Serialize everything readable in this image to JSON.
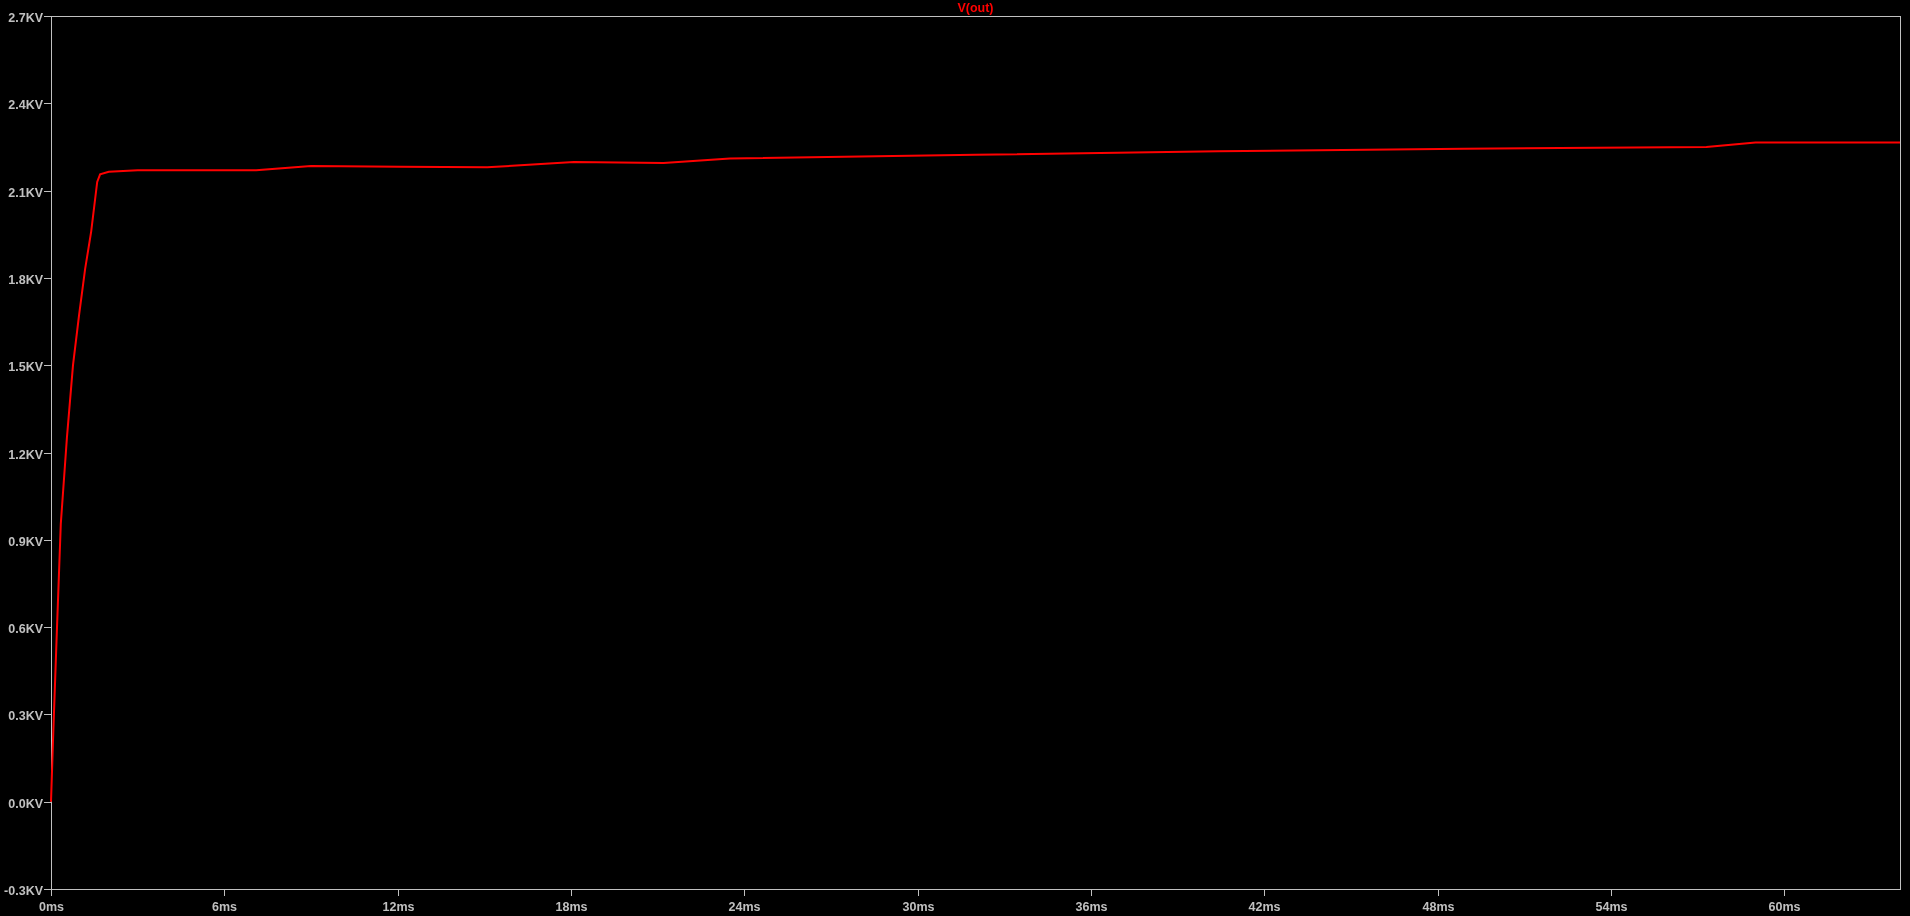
{
  "chart_data": {
    "type": "line",
    "x": [
      0,
      0.08,
      0.2,
      0.34,
      0.55,
      0.76,
      0.97,
      1.18,
      1.39,
      1.6,
      1.7,
      2.0,
      3.0,
      7.1,
      9,
      12.1,
      15.1,
      18.1,
      21.2,
      23.5,
      32,
      40.4,
      48.9,
      57.3,
      59,
      64
    ],
    "series": [
      {
        "name": "V(out)",
        "color": "#ff0000",
        "values": [
          0,
          0.24,
          0.58,
          0.955,
          1.25,
          1.5,
          1.67,
          1.83,
          1.96,
          2.13,
          2.156,
          2.165,
          2.17,
          2.17,
          2.185,
          2.182,
          2.18,
          2.198,
          2.195,
          2.21,
          2.223,
          2.235,
          2.244,
          2.25,
          2.265,
          2.265
        ]
      }
    ],
    "xlim": [
      0,
      64
    ],
    "ylim": [
      -0.3,
      2.7
    ],
    "xticks": [
      {
        "value": 0,
        "label": "0ms"
      },
      {
        "value": 6,
        "label": "6ms"
      },
      {
        "value": 12,
        "label": "12ms"
      },
      {
        "value": 18,
        "label": "18ms"
      },
      {
        "value": 24,
        "label": "24ms"
      },
      {
        "value": 30,
        "label": "30ms"
      },
      {
        "value": 36,
        "label": "36ms"
      },
      {
        "value": 42,
        "label": "42ms"
      },
      {
        "value": 48,
        "label": "48ms"
      },
      {
        "value": 54,
        "label": "54ms"
      },
      {
        "value": 60,
        "label": "60ms"
      }
    ],
    "yticks": [
      {
        "value": -0.3,
        "label": "-0.3KV"
      },
      {
        "value": 0,
        "label": "0.0KV"
      },
      {
        "value": 0.3,
        "label": "0.3KV"
      },
      {
        "value": 0.6,
        "label": "0.6KV"
      },
      {
        "value": 0.9,
        "label": "0.9KV"
      },
      {
        "value": 1.2,
        "label": "1.2KV"
      },
      {
        "value": 1.5,
        "label": "1.5KV"
      },
      {
        "value": 1.8,
        "label": "1.8KV"
      },
      {
        "value": 2.1,
        "label": "2.1KV"
      },
      {
        "value": 2.4,
        "label": "2.4KV"
      },
      {
        "value": 2.7,
        "label": "2.7KV"
      }
    ]
  }
}
